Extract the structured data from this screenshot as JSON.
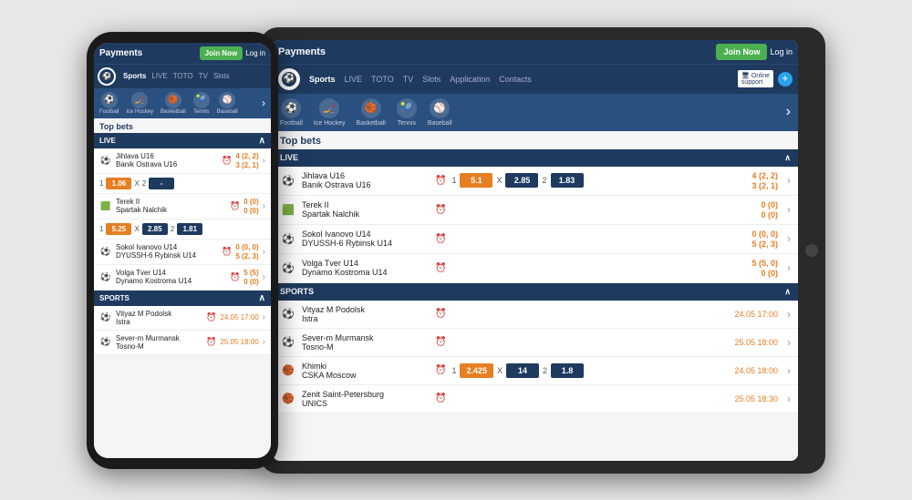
{
  "phone": {
    "header": {
      "title": "Payments",
      "join_label": "Join Now",
      "login_label": "Log in"
    },
    "nav": {
      "logo_text": "⚽",
      "items": [
        {
          "label": "Sports",
          "active": true
        },
        {
          "label": "LIVE"
        },
        {
          "label": "TOTO"
        },
        {
          "label": "TV"
        },
        {
          "label": "Slots"
        }
      ]
    },
    "sport_icons": [
      {
        "icon": "⚽",
        "label": "Football"
      },
      {
        "icon": "🏒",
        "label": "Ice Hockey"
      },
      {
        "icon": "🏀",
        "label": "Basketball"
      },
      {
        "icon": "🎾",
        "label": "Tennis"
      },
      {
        "icon": "⚾",
        "label": "Baseball"
      }
    ],
    "top_bets_title": "Top bets",
    "sections": [
      {
        "name": "LIVE",
        "matches": [
          {
            "team1": "Jihlava U16",
            "team2": "Banik Ostrava U16",
            "odd1": "4 (2, 2)",
            "odd2": "3 (2, 1)",
            "has_odds_row": true,
            "odds": {
              "label1": "1",
              "val1": "1.06",
              "x": "X",
              "label2": "2",
              "val2": "-"
            }
          },
          {
            "team1": "Terek II",
            "team2": "Spartak Nalchik",
            "odd1": "0 (0)",
            "odd2": "0 (0)",
            "has_odds_row": true,
            "odds": {
              "label1": "1",
              "val1": "5.25",
              "x": "X",
              "xval": "2.85",
              "label2": "2",
              "val2": "1.81"
            }
          },
          {
            "team1": "Sokol Ivanovo U14",
            "team2": "DYUSSH-6 Rybinsk U14",
            "odd1": "0 (0, 0)",
            "odd2": "5 (2, 3)",
            "has_odds_row": false
          },
          {
            "team1": "Volga Tver U14",
            "team2": "Dynamo Kostroma U14",
            "odd1": "5 (5)",
            "odd2": "0 (0)",
            "has_odds_row": false
          }
        ]
      },
      {
        "name": "SPORTS",
        "matches": [
          {
            "team1": "Vityaz M Podolsk",
            "team2": "Istra",
            "date": "24.05 17:00",
            "has_odds_row": false
          },
          {
            "team1": "Sever-m Murmansk",
            "team2": "Tosno-M",
            "date": "25.05 18:00",
            "has_odds_row": false
          }
        ]
      }
    ]
  },
  "tablet": {
    "header": {
      "title": "Payments",
      "join_label": "Join Now",
      "login_label": "Log in"
    },
    "nav": {
      "items": [
        {
          "label": "Sports",
          "active": true
        },
        {
          "label": "LIVE"
        },
        {
          "label": "TOTO"
        },
        {
          "label": "TV"
        },
        {
          "label": "Slots"
        },
        {
          "label": "Application"
        },
        {
          "label": "Contacts"
        }
      ],
      "support_label": "Online support"
    },
    "sport_icons": [
      {
        "icon": "⚽",
        "label": "Football"
      },
      {
        "icon": "🏒",
        "label": "Ice Hockey"
      },
      {
        "icon": "🏀",
        "label": "Basketball"
      },
      {
        "icon": "🎾",
        "label": "Tennis"
      },
      {
        "icon": "⚾",
        "label": "Baseball"
      }
    ],
    "top_bets_title": "Top bets",
    "sections": [
      {
        "name": "LIVE",
        "matches": [
          {
            "team1": "Jihlava U16",
            "team2": "Banik Ostrava U16",
            "odd1": "4 (2, 2)",
            "odd2": "3 (2, 1)",
            "has_odds_row": true,
            "odds": {
              "label1": "1",
              "val1": "5.1",
              "x": "X",
              "xval": "2.85",
              "label2": "2",
              "val2": "1.83"
            }
          },
          {
            "team1": "Terek II",
            "team2": "Spartak Nalchik",
            "odd1": "0 (0)",
            "odd2": "0 (0)",
            "has_odds_row": false
          },
          {
            "team1": "Sokol Ivanovo U14",
            "team2": "DYUSSH-6 Rybinsk U14",
            "odd1": "0 (0, 0)",
            "odd2": "5 (2, 3)",
            "has_odds_row": false
          },
          {
            "team1": "Volga Tver U14",
            "team2": "Dynamo Kostroma U14",
            "odd1": "5 (5, 0)",
            "odd2": "0 (0)",
            "has_odds_row": false
          }
        ]
      },
      {
        "name": "SPORTS",
        "matches": [
          {
            "team1": "Vityaz M Podolsk",
            "team2": "Istra",
            "date": "24.05 17:00",
            "has_odds_row": false
          },
          {
            "team1": "Sever-m Murmansk",
            "team2": "Tosno-M",
            "date": "25.05 18:00",
            "has_odds_row": false
          },
          {
            "team1": "Khimki",
            "team2": "CSKA Moscow",
            "date": "24.05 18:00",
            "has_odds_row": true,
            "odds": {
              "label1": "1",
              "val1": "2.425",
              "x": "X",
              "xval": "14",
              "label2": "2",
              "val2": "1.8"
            }
          },
          {
            "team1": "Zenit Saint-Petersburg",
            "team2": "UNICS",
            "date": "25.05 18:30",
            "has_odds_row": false
          }
        ]
      }
    ]
  }
}
